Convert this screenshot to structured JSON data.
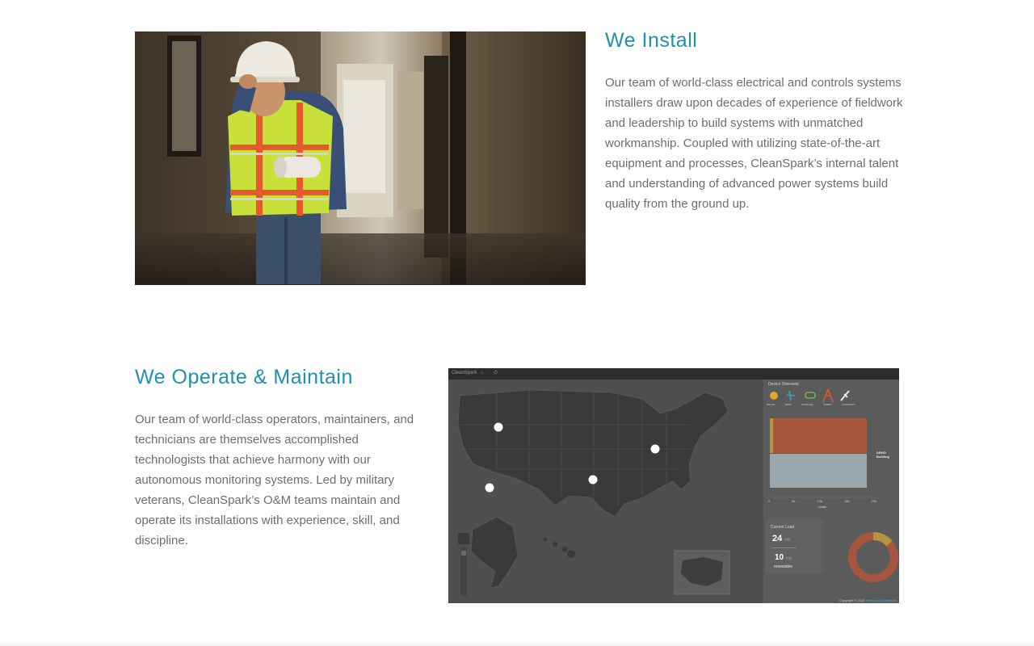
{
  "install": {
    "title": "We Install",
    "body": "Our team of world-class electrical and controls systems installers draw upon decades of experience of fieldwork and leadership to build systems with unmatched workmanship. Coupled with utilizing state-of-the-art equipment and processes, CleanSpark’s internal talent and understanding of advanced power systems build quality from the ground up."
  },
  "operate": {
    "title": "We Operate & Maintain",
    "body": "Our team of world-class operators, maintainers, and technicians are themselves accomplished technologists that achieve harmony with our autonomous monitoring systems.  Led by military veterans, CleanSpark’s O&M teams maintain and operate its installations with experience, skill, and discipline."
  },
  "dashboard": {
    "brand": "CleanSpark",
    "home_icon": "home-icon",
    "power_icon": "power-icon",
    "panel_title": "Device Overview",
    "device_labels": [
      "SOLAR",
      "WIND",
      "STORAGE",
      "TURBIT",
      "CONTRACT"
    ],
    "bar_label": "DEMO Building",
    "axis_ticks": [
      "0",
      "5k",
      "10k",
      "15k",
      "20k"
    ],
    "axis_label": "Watts",
    "current_load_label": "Current Load",
    "current_load_value": "24",
    "current_load_unit": "kW",
    "renewable_value": "10",
    "renewable_unit": "kW",
    "renewable_label": "renewable",
    "footer_text": "Copyright © 2014",
    "footer_link": "Terms and Conditions",
    "colors": {
      "accent": "#1f8fb4",
      "bar_top": "#a6563e",
      "bar_bottom": "#9aa8ad",
      "donut_main": "#a6563e",
      "donut_secondary": "#b8923e"
    }
  }
}
